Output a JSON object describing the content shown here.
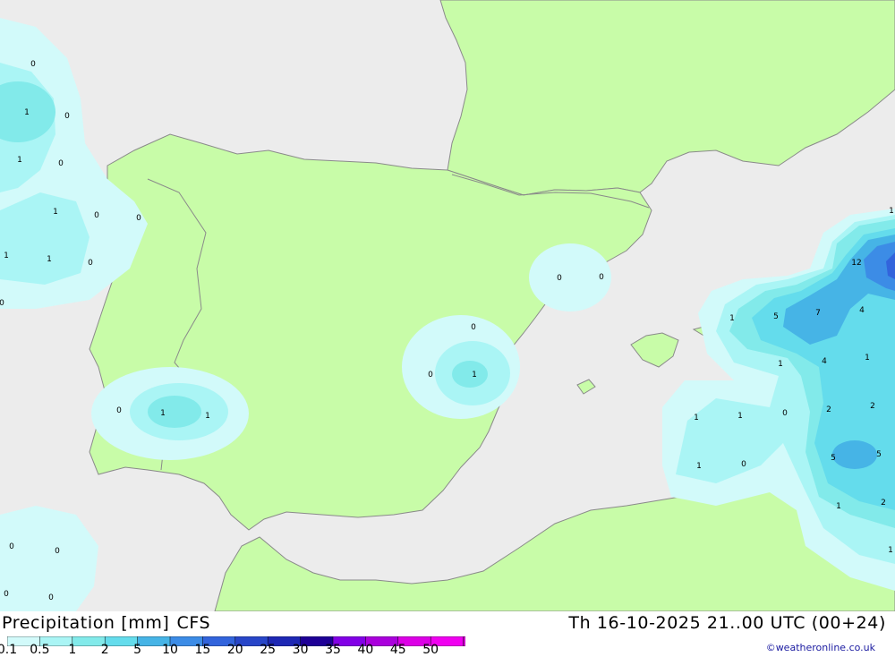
{
  "title": {
    "label": "Precipitation [mm]",
    "model": "CFS",
    "datetime": "Th 16-10-2025 21..00 UTC (00+24)",
    "credit": "©weatheronline.co.uk"
  },
  "colors": {
    "sea": "#ececec",
    "land": "#c8fca8",
    "border": "#8a8a8a",
    "scale": [
      "#d2fafa",
      "#aaf5f5",
      "#82eaea",
      "#64dcec",
      "#46b4e6",
      "#3c8ce6",
      "#3264dc",
      "#2846c8",
      "#1e28b4",
      "#1e0096",
      "#8200e6",
      "#aa00dc",
      "#dc00e6",
      "#f000f0",
      "#c800c8",
      "#a0008c"
    ]
  },
  "legend": {
    "labels": [
      "0.1",
      "0.5",
      "1",
      "2",
      "5",
      "10",
      "15",
      "20",
      "25",
      "30",
      "35",
      "40",
      "45",
      "50"
    ]
  },
  "contour_labels": [
    "0",
    "1",
    "0",
    "1",
    "0",
    "1",
    "0",
    "0",
    "1",
    "1",
    "0",
    "0",
    "0",
    "0",
    "1",
    "0",
    "1",
    "0",
    "1",
    "0",
    "0",
    "0",
    "0",
    "1",
    "12",
    "1",
    "5",
    "7",
    "4",
    "1",
    "4",
    "1",
    "1",
    "1",
    "0",
    "2",
    "2",
    "1",
    "0",
    "5",
    "5",
    "1",
    "2",
    "1",
    "0",
    "0",
    "0",
    "0"
  ]
}
